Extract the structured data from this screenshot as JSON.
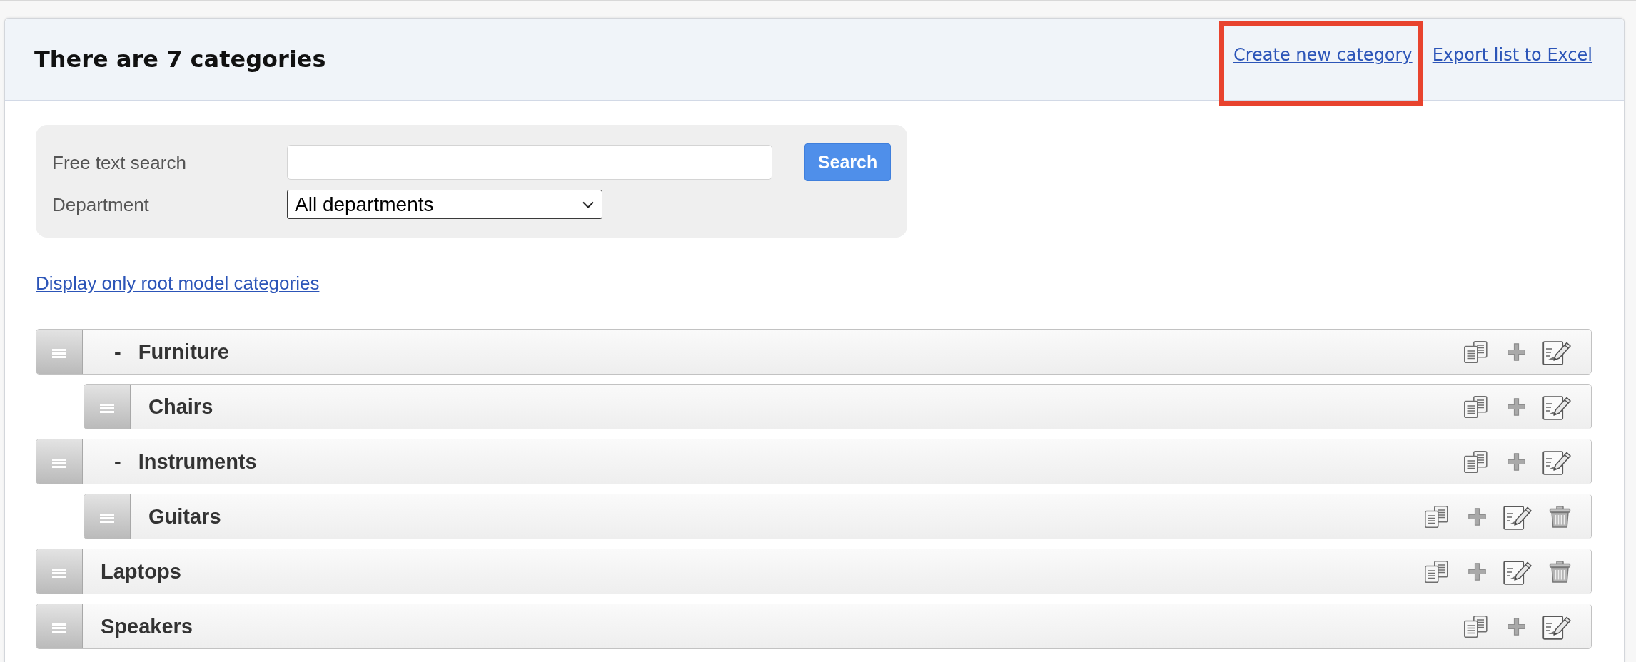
{
  "header": {
    "title": "There are 7 categories",
    "links": [
      {
        "label": "Create new category",
        "highlighted": true
      },
      {
        "label": "Export list to Excel",
        "highlighted": false
      }
    ]
  },
  "search_form": {
    "fields": [
      {
        "kind": "text",
        "label": "Free text search"
      },
      {
        "kind": "select",
        "label": "Department",
        "value": "All departments"
      }
    ],
    "button": "Search"
  },
  "root_filter_link": "Display only root model categories",
  "categories": [
    {
      "name": "Furniture",
      "toggle": "-",
      "expanded": true,
      "actions": [
        {
          "kind": "copy"
        },
        {
          "kind": "add"
        },
        {
          "kind": "edit"
        }
      ],
      "children": [
        {
          "name": "Chairs",
          "actions": [
            {
              "kind": "copy"
            },
            {
              "kind": "add"
            },
            {
              "kind": "edit"
            }
          ]
        }
      ]
    },
    {
      "name": "Instruments",
      "toggle": "-",
      "expanded": true,
      "actions": [
        {
          "kind": "copy"
        },
        {
          "kind": "add"
        },
        {
          "kind": "edit"
        }
      ],
      "children": [
        {
          "name": "Guitars",
          "actions": [
            {
              "kind": "copy"
            },
            {
              "kind": "add"
            },
            {
              "kind": "edit"
            },
            {
              "kind": "delete"
            }
          ]
        }
      ]
    },
    {
      "name": "Laptops",
      "actions": [
        {
          "kind": "copy"
        },
        {
          "kind": "add"
        },
        {
          "kind": "edit"
        },
        {
          "kind": "delete"
        }
      ]
    },
    {
      "name": "Speakers",
      "actions": [
        {
          "kind": "copy"
        },
        {
          "kind": "add"
        },
        {
          "kind": "edit"
        }
      ]
    }
  ]
}
